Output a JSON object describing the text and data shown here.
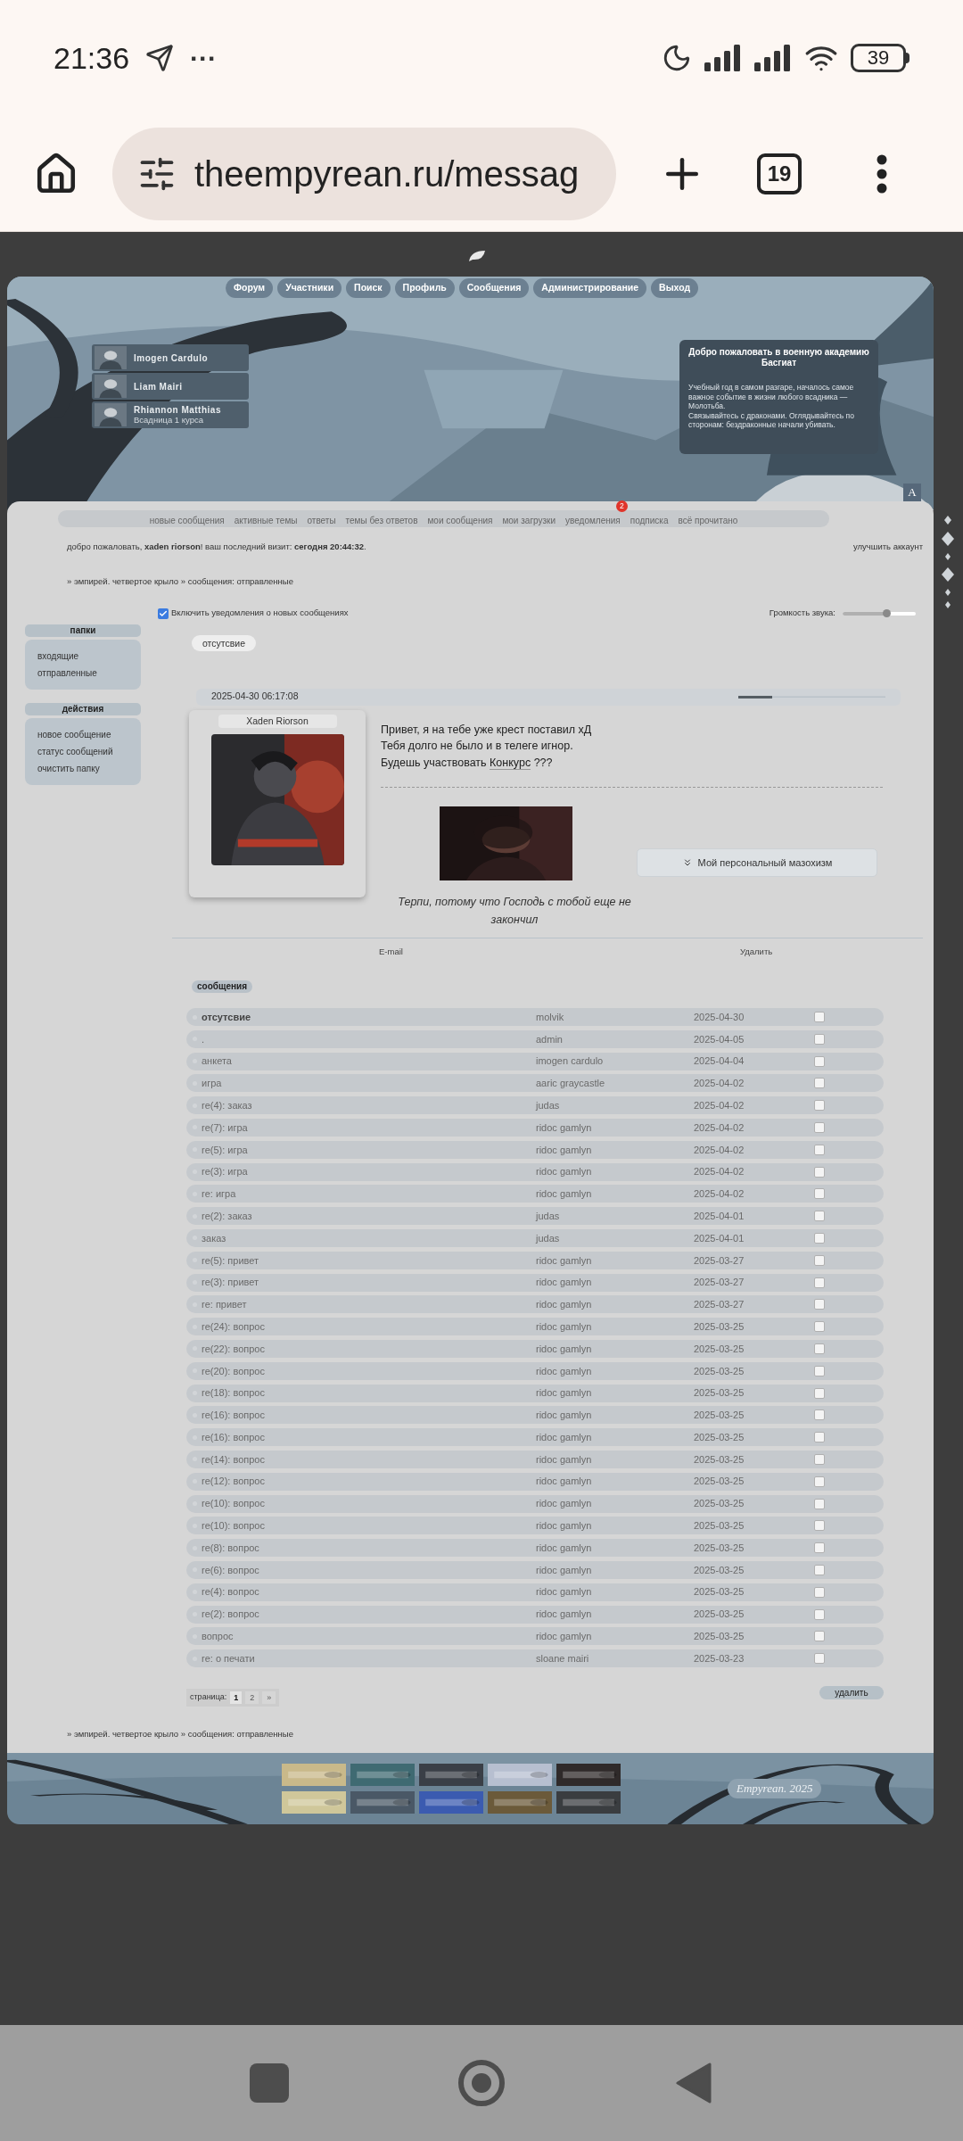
{
  "status_bar": {
    "time": "21:36",
    "more": "···",
    "battery": "39"
  },
  "browser": {
    "url": "theempyrean.ru/messag",
    "tab_count": "19"
  },
  "top_nav": [
    {
      "label": "Форум"
    },
    {
      "label": "Участники"
    },
    {
      "label": "Поиск"
    },
    {
      "label": "Профиль"
    },
    {
      "label": "Сообщения"
    },
    {
      "label": "Администрирование"
    },
    {
      "label": "Выход"
    }
  ],
  "online_users": [
    {
      "name": "Imogen Cardulo"
    },
    {
      "name": "Liam Mairi"
    },
    {
      "name": "Rhiannon Matthias",
      "subtitle": "Всадница 1 курса"
    }
  ],
  "welcome_box": {
    "title": "Добро пожаловать в военную академию Басгиат",
    "text": "Учебный год в самом разгаре, началось самое важное событие в жизни любого всадника — Молотьба.\nСвязывайтесь с драконами. Оглядывайтесь по сторонам: бездраконные начали убивать."
  },
  "font_button": "A",
  "sub_nav": [
    {
      "label": "новые сообщения"
    },
    {
      "label": "активные темы"
    },
    {
      "label": "ответы"
    },
    {
      "label": "темы без ответов"
    },
    {
      "label": "мои сообщения"
    },
    {
      "label": "мои загрузки"
    },
    {
      "label": "уведомления",
      "badge": "2"
    },
    {
      "label": "подписка"
    },
    {
      "label": "всё прочитано"
    }
  ],
  "greeting": "добро пожаловать, **xaden riorson**!  ваш последний визит: **сегодня 20:44:32**.",
  "upgrade_link": "улучшить аккаунт",
  "breadcrumb": "» эмпирей. четвертое крыло » сообщения: отправленные",
  "notifications": {
    "label": "Включить уведомления о новых сообщениях",
    "checked": true
  },
  "volume": {
    "label": "Громкость звука:",
    "level": 0.6
  },
  "sidebar": [
    {
      "title": "папки",
      "items": [
        "входящие",
        "отправленные"
      ]
    },
    {
      "title": "действия",
      "items": [
        "новое сообщение",
        "статус сообщений",
        "очистить папку"
      ]
    }
  ],
  "subject_tag": "отсутсвие",
  "post": {
    "date": "2025-04-30 06:17:08",
    "author": "Xaden Riorson",
    "lines": [
      "Привет, я на тебе уже крест поставил хД",
      "Тебя долго не было и в телеге игнор."
    ],
    "last_line": {
      "text": "Будешь участвовать",
      "link": "Конкурс",
      "tail": "???"
    },
    "spoiler": "Мой персональный мазохизм",
    "signature": "Терпи, потому что Господь с тобой еще не закончил"
  },
  "post_actions": [
    "E-mail",
    "Удалить"
  ],
  "table": {
    "caption": "сообщения",
    "rows": [
      {
        "subject": "отсутсвие",
        "author": "molvik",
        "date": "2025-04-30",
        "unread": true,
        "checked": false
      },
      {
        "subject": ".",
        "author": "admin",
        "date": "2025-04-05",
        "unread": false,
        "checked": false
      },
      {
        "subject": "анкета",
        "author": "imogen cardulo",
        "date": "2025-04-04",
        "unread": false,
        "checked": false
      },
      {
        "subject": "игра",
        "author": "aaric graycastle",
        "date": "2025-04-02",
        "unread": false,
        "checked": false
      },
      {
        "subject": "re(4): заказ",
        "author": "judas",
        "date": "2025-04-02",
        "unread": false,
        "checked": false
      },
      {
        "subject": "re(7): игра",
        "author": "ridoc gamlyn",
        "date": "2025-04-02",
        "unread": false,
        "checked": false
      },
      {
        "subject": "re(5): игра",
        "author": "ridoc gamlyn",
        "date": "2025-04-02",
        "unread": false,
        "checked": false
      },
      {
        "subject": "re(3): игра",
        "author": "ridoc gamlyn",
        "date": "2025-04-02",
        "unread": false,
        "checked": false
      },
      {
        "subject": "re: игра",
        "author": "ridoc gamlyn",
        "date": "2025-04-02",
        "unread": false,
        "checked": false
      },
      {
        "subject": "re(2): заказ",
        "author": "judas",
        "date": "2025-04-01",
        "unread": false,
        "checked": false
      },
      {
        "subject": "заказ",
        "author": "judas",
        "date": "2025-04-01",
        "unread": false,
        "checked": false
      },
      {
        "subject": "re(5): привет",
        "author": "ridoc gamlyn",
        "date": "2025-03-27",
        "unread": false,
        "checked": false
      },
      {
        "subject": "re(3): привет",
        "author": "ridoc gamlyn",
        "date": "2025-03-27",
        "unread": false,
        "checked": false
      },
      {
        "subject": "re: привет",
        "author": "ridoc gamlyn",
        "date": "2025-03-27",
        "unread": false,
        "checked": false
      },
      {
        "subject": "re(24): вопрос",
        "author": "ridoc gamlyn",
        "date": "2025-03-25",
        "unread": false,
        "checked": false
      },
      {
        "subject": "re(22): вопрос",
        "author": "ridoc gamlyn",
        "date": "2025-03-25",
        "unread": false,
        "checked": false
      },
      {
        "subject": "re(20): вопрос",
        "author": "ridoc gamlyn",
        "date": "2025-03-25",
        "unread": false,
        "checked": false
      },
      {
        "subject": "re(18): вопрос",
        "author": "ridoc gamlyn",
        "date": "2025-03-25",
        "unread": false,
        "checked": false
      },
      {
        "subject": "re(16): вопрос",
        "author": "ridoc gamlyn",
        "date": "2025-03-25",
        "unread": false,
        "checked": false
      },
      {
        "subject": "re(16): вопрос",
        "author": "ridoc gamlyn",
        "date": "2025-03-25",
        "unread": false,
        "checked": false
      },
      {
        "subject": "re(14): вопрос",
        "author": "ridoc gamlyn",
        "date": "2025-03-25",
        "unread": false,
        "checked": false
      },
      {
        "subject": "re(12): вопрос",
        "author": "ridoc gamlyn",
        "date": "2025-03-25",
        "unread": false,
        "checked": false
      },
      {
        "subject": "re(10): вопрос",
        "author": "ridoc gamlyn",
        "date": "2025-03-25",
        "unread": false,
        "checked": false
      },
      {
        "subject": "re(10): вопрос",
        "author": "ridoc gamlyn",
        "date": "2025-03-25",
        "unread": false,
        "checked": false
      },
      {
        "subject": "re(8): вопрос",
        "author": "ridoc gamlyn",
        "date": "2025-03-25",
        "unread": false,
        "checked": false
      },
      {
        "subject": "re(6): вопрос",
        "author": "ridoc gamlyn",
        "date": "2025-03-25",
        "unread": false,
        "checked": false
      },
      {
        "subject": "re(4): вопрос",
        "author": "ridoc gamlyn",
        "date": "2025-03-25",
        "unread": false,
        "checked": false
      },
      {
        "subject": "re(2): вопрос",
        "author": "ridoc gamlyn",
        "date": "2025-03-25",
        "unread": false,
        "checked": false
      },
      {
        "subject": "вопрос",
        "author": "ridoc gamlyn",
        "date": "2025-03-25",
        "unread": false,
        "checked": false
      },
      {
        "subject": "re: о печати",
        "author": "sloane mairi",
        "date": "2025-03-23",
        "unread": false,
        "checked": false
      }
    ]
  },
  "pagination": {
    "label": "страница:",
    "pages": [
      {
        "label": "1",
        "selected": true
      },
      {
        "label": "2",
        "selected": false
      }
    ],
    "next": "»"
  },
  "delete_button": "удалить",
  "footer": {
    "breadcrumb": "» эмпирей. четвертое крыло » сообщения: отправленные",
    "copyright": "Empyrean. 2025"
  }
}
